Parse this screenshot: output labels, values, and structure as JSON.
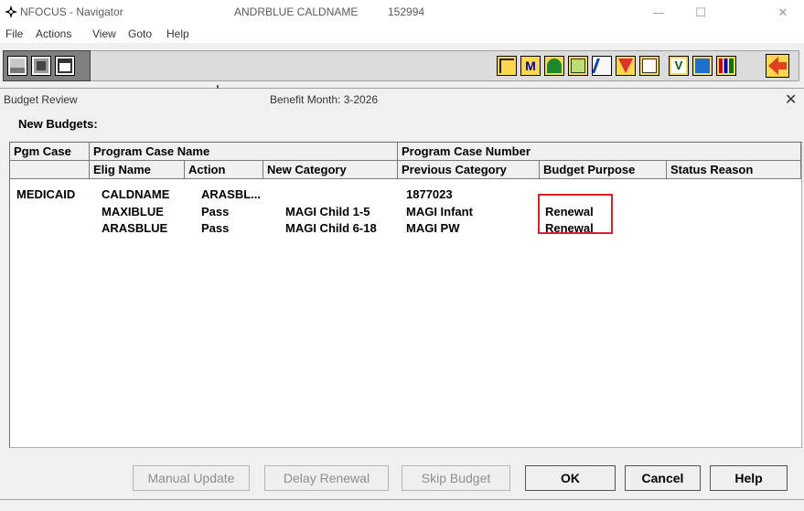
{
  "window": {
    "app_title": "NFOCUS - Navigator",
    "user_name": "ANDRBLUE CALDNAME",
    "user_id": "152994",
    "minimize": "—",
    "maximize": "☐",
    "close": "✕"
  },
  "menu": [
    "File",
    "Actions",
    "View",
    "Goto",
    "Help"
  ],
  "dialog": {
    "title": "Budget Review",
    "benefit_month": "Benefit Month: 3-2026",
    "close": "✕",
    "section_label": "New Budgets:"
  },
  "grid": {
    "header_row1": [
      "Pgm Case",
      "Program Case Name",
      "Program Case Number"
    ],
    "header_row2": [
      "Elig Name",
      "Action",
      "New Category",
      "Previous Category",
      "Budget Purpose",
      "Status Reason"
    ],
    "group": {
      "pgm_case": "MEDICAID",
      "case_name": "CALDNAME",
      "case_action": "ARASBL...",
      "case_number": "1877023"
    },
    "rows": [
      {
        "elig_name": "MAXIBLUE",
        "action": "Pass",
        "new_category": "MAGI Child 1-5",
        "previous_category": "MAGI Infant",
        "budget_purpose": "Renewal",
        "status_reason": ""
      },
      {
        "elig_name": "ARASBLUE",
        "action": "Pass",
        "new_category": "MAGI Child 6-18",
        "previous_category": "MAGI PW",
        "budget_purpose": "Renewal",
        "status_reason": ""
      }
    ],
    "highlight_color": "#e02020"
  },
  "buttons": {
    "manual_update": "Manual Update",
    "delay_renewal": "Delay Renewal",
    "skip_budget": "Skip Budget",
    "ok": "OK",
    "cancel": "Cancel",
    "help": "Help"
  },
  "toolbar_icons": [
    "open-folder-icon",
    "save-icon",
    "new-folder-icon",
    "program-icon",
    "m-icon",
    "person-icon",
    "notes-icon",
    "edit-icon",
    "correspondence-icon",
    "calculator-icon",
    "v-icon",
    "grid-icon",
    "bar-chart-icon",
    "exit-icon"
  ]
}
